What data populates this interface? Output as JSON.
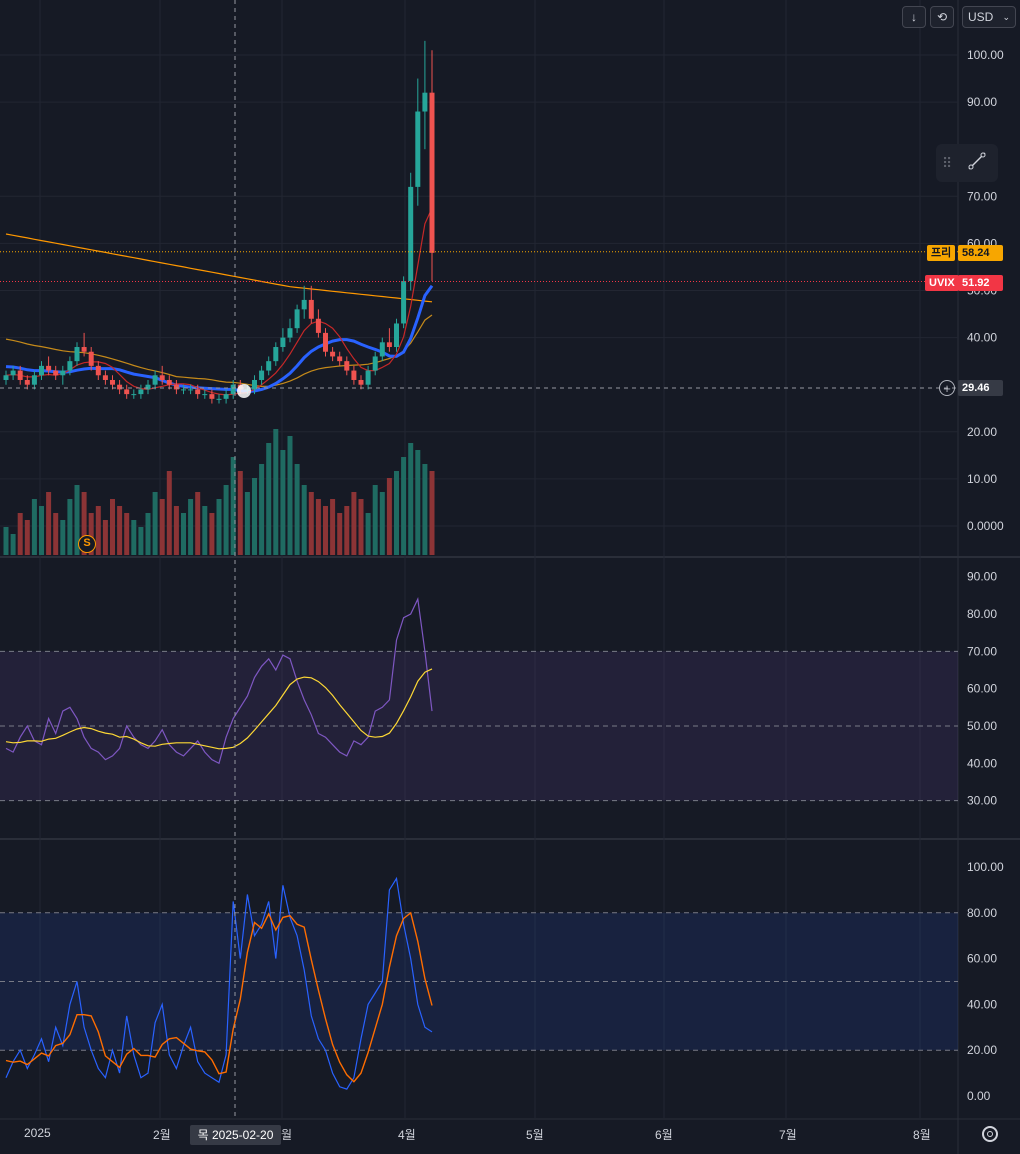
{
  "toolbar": {
    "download_icon": "arrow-down-icon",
    "replay_icon": "replay-icon",
    "currency": "USD"
  },
  "price_axis": {
    "main_ticks": [
      "100.00",
      "90.00",
      "70.00",
      "60.00",
      "50.00",
      "40.00",
      "20.00",
      "10.00",
      "0.0000"
    ],
    "rsi_ticks": [
      "90.00",
      "80.00",
      "70.00",
      "60.00",
      "50.00",
      "40.00",
      "30.00"
    ],
    "stoch_ticks": [
      "100.00",
      "80.00",
      "60.00",
      "40.00",
      "20.00",
      "0.00"
    ]
  },
  "tags": {
    "pre": {
      "label": "프리",
      "value": "58.24",
      "color": "#f7a600"
    },
    "uvix": {
      "label": "UVIX",
      "value": "51.92",
      "color": "#f23645"
    },
    "crosshair": {
      "value": "29.46"
    }
  },
  "time_axis": {
    "labels": [
      "2025",
      "2월",
      "월",
      "4월",
      "5월",
      "6월",
      "7월",
      "8월"
    ],
    "crosshair_date": "목 2025-02-20"
  },
  "markers": {
    "s_badge": "S"
  },
  "colors": {
    "up": "#26a69a",
    "down": "#ef5350",
    "ma_fast": "#e53935",
    "ma_mid": "#f7a600",
    "ma_slow_orange": "#ff9800",
    "ma_blue": "#2962ff",
    "rsi": "#7e57c2",
    "rsi_signal": "#fdd835",
    "stoch_k": "#2962ff",
    "stoch_d": "#ff6d00"
  },
  "chart_data": {
    "type": "candlestick",
    "ylim": [
      0,
      105
    ],
    "candles": [
      [
        31,
        33,
        30,
        32
      ],
      [
        32,
        34,
        31,
        33
      ],
      [
        33,
        34,
        30,
        31
      ],
      [
        31,
        32,
        29,
        30
      ],
      [
        30,
        33,
        29,
        32
      ],
      [
        32,
        35,
        31,
        34
      ],
      [
        34,
        36,
        32,
        33
      ],
      [
        33,
        34,
        31,
        32
      ],
      [
        32,
        34,
        30,
        33
      ],
      [
        33,
        36,
        32,
        35
      ],
      [
        35,
        39,
        34,
        38
      ],
      [
        38,
        41,
        36,
        37
      ],
      [
        37,
        38,
        33,
        34
      ],
      [
        34,
        35,
        31,
        32
      ],
      [
        32,
        33,
        30,
        31
      ],
      [
        31,
        32,
        29,
        30
      ],
      [
        30,
        31,
        28,
        29
      ],
      [
        29,
        30,
        27,
        28
      ],
      [
        28,
        29,
        27,
        28
      ],
      [
        28,
        30,
        27,
        29
      ],
      [
        29,
        31,
        28,
        30
      ],
      [
        30,
        33,
        29,
        32
      ],
      [
        32,
        34,
        30,
        31
      ],
      [
        31,
        32,
        29,
        30
      ],
      [
        30,
        31,
        28,
        29
      ],
      [
        29,
        30,
        28,
        29
      ],
      [
        29,
        30,
        28,
        29
      ],
      [
        29,
        30,
        27,
        28
      ],
      [
        28,
        29,
        27,
        28
      ],
      [
        28,
        29,
        26,
        27
      ],
      [
        27,
        28,
        26,
        27
      ],
      [
        27,
        29,
        26,
        28
      ],
      [
        28,
        31,
        27,
        30
      ],
      [
        30,
        31,
        28,
        29
      ],
      [
        29,
        30,
        28,
        29
      ],
      [
        29,
        32,
        28,
        31
      ],
      [
        31,
        34,
        30,
        33
      ],
      [
        33,
        36,
        32,
        35
      ],
      [
        35,
        39,
        34,
        38
      ],
      [
        38,
        42,
        37,
        40
      ],
      [
        40,
        44,
        39,
        42
      ],
      [
        42,
        47,
        41,
        46
      ],
      [
        46,
        51,
        44,
        48
      ],
      [
        48,
        51,
        43,
        44
      ],
      [
        44,
        46,
        40,
        41
      ],
      [
        41,
        42,
        36,
        37
      ],
      [
        37,
        38,
        35,
        36
      ],
      [
        36,
        37,
        34,
        35
      ],
      [
        35,
        36,
        32,
        33
      ],
      [
        33,
        34,
        30,
        31
      ],
      [
        31,
        32,
        29,
        30
      ],
      [
        30,
        34,
        29,
        33
      ],
      [
        33,
        37,
        32,
        36
      ],
      [
        36,
        40,
        35,
        39
      ],
      [
        39,
        42,
        37,
        38
      ],
      [
        38,
        44,
        37,
        43
      ],
      [
        43,
        53,
        42,
        52
      ],
      [
        52,
        75,
        50,
        72
      ],
      [
        72,
        95,
        68,
        88
      ],
      [
        88,
        103,
        80,
        92
      ],
      [
        92,
        101,
        52,
        58
      ]
    ],
    "volume": [
      4,
      3,
      6,
      5,
      8,
      7,
      9,
      6,
      5,
      8,
      10,
      9,
      6,
      7,
      5,
      8,
      7,
      6,
      5,
      4,
      6,
      9,
      8,
      12,
      7,
      6,
      8,
      9,
      7,
      6,
      8,
      10,
      14,
      12,
      9,
      11,
      13,
      16,
      18,
      15,
      17,
      13,
      10,
      9,
      8,
      7,
      8,
      6,
      7,
      9,
      8,
      6,
      10,
      9,
      11,
      12,
      14,
      16,
      15,
      13,
      12
    ],
    "rsi": {
      "ylim": [
        20,
        95
      ],
      "bands": [
        30,
        50,
        70
      ]
    },
    "stoch": {
      "ylim": [
        -5,
        105
      ],
      "bands": [
        20,
        50,
        80
      ]
    }
  }
}
